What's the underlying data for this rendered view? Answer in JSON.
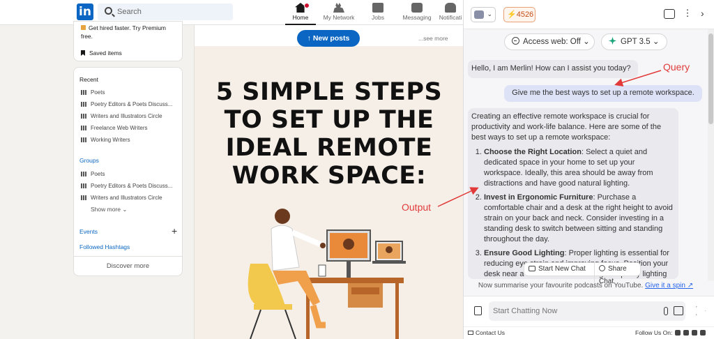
{
  "linkedin": {
    "logo": "in",
    "search_placeholder": "Search",
    "nav": [
      {
        "label": "Home",
        "icon": "home-icon"
      },
      {
        "label": "My Network",
        "icon": "network-icon"
      },
      {
        "label": "Jobs",
        "icon": "briefcase-icon"
      },
      {
        "label": "Messaging",
        "icon": "messaging-icon"
      },
      {
        "label": "Notificati",
        "icon": "bell-icon"
      }
    ],
    "premium_text": "Get hired faster. Try Premium free.",
    "saved_items": "Saved items",
    "recent": {
      "title": "Recent",
      "items": [
        "Poets",
        "Poetry Editors & Poets Discuss...",
        "Writers and Illustrators Circle",
        "Freelance Web Writers",
        "Working Writers"
      ]
    },
    "groups": {
      "title": "Groups",
      "items": [
        "Poets",
        "Poetry Editors & Poets Discuss...",
        "Writers and Illustrators Circle"
      ],
      "show_more": "Show more"
    },
    "events": "Events",
    "followed_hashtags": "Followed Hashtags",
    "discover_more": "Discover more",
    "new_posts": "↑ New posts",
    "see_more": "...see more",
    "post_title": "5 SIMPLE STEPS TO SET UP THE IDEAL REMOTE WORK SPACE:"
  },
  "merlin": {
    "credits": "4526",
    "access_web": "Access web: Off",
    "model": "GPT 3.5",
    "greeting": "Hello, I am Merlin! How can I assist you today?",
    "query": "Give me the best ways to set up a remote workspace.",
    "response_intro": "Creating an effective remote workspace is crucial for productivity and work-life balance. Here are some of the best ways to set up a remote workspace:",
    "response_items": [
      {
        "title": "Choose the Right Location",
        "text": ": Select a quiet and dedicated space in your home to set up your workspace. Ideally, this area should be away from distractions and have good natural lighting."
      },
      {
        "title": "Invest in Ergonomic Furniture",
        "text": ": Purchase a comfortable chair and a desk at the right height to avoid strain on your back and neck. Consider investing in a standing desk to switch between sitting and standing throughout the day."
      },
      {
        "title": "Ensure Good Lighting",
        "text": ": Proper lighting is essential for reducing eye strain and improving focus. Position your desk near a window and invest in good quality lighting fixtures."
      }
    ],
    "start_new_chat": "Start New Chat",
    "share_chat": "Share Chat",
    "suggestion": "Now summarise your favourite podcasts on YouTube.",
    "suggestion_link": "Give it a spin ↗",
    "input_placeholder": "Start Chatting Now",
    "contact_us": "Contact Us",
    "follow_us": "Follow Us On:"
  },
  "annotations": {
    "query": "Query",
    "output": "Output",
    "color": "#e23a3a"
  }
}
